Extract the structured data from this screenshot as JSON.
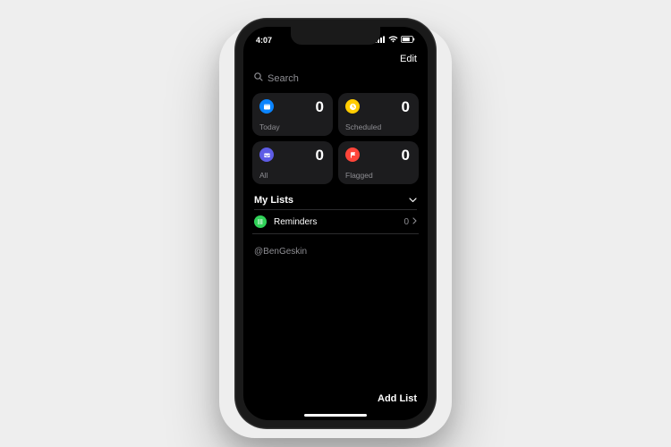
{
  "status": {
    "time": "4:07"
  },
  "nav": {
    "edit": "Edit"
  },
  "search": {
    "placeholder": "Search"
  },
  "cards": {
    "today": {
      "label": "Today",
      "count": "0",
      "color": "#0a84ff"
    },
    "scheduled": {
      "label": "Scheduled",
      "count": "0",
      "color": "#ffcc00"
    },
    "all": {
      "label": "All",
      "count": "0",
      "color": "#5e5ce6"
    },
    "flagged": {
      "label": "Flagged",
      "count": "0",
      "color": "#ff453a"
    }
  },
  "section": {
    "title": "My Lists"
  },
  "lists": [
    {
      "name": "Reminders",
      "count": "0",
      "color": "#30d158"
    }
  ],
  "credit": "@BenGeskin",
  "footer": {
    "add_list": "Add List"
  }
}
